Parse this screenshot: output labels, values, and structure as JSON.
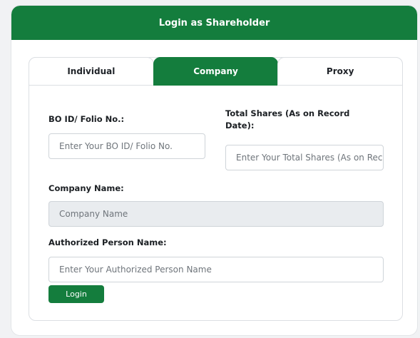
{
  "header": {
    "title": "Login as Shareholder"
  },
  "tabs": [
    {
      "label": "Individual",
      "active": false
    },
    {
      "label": "Company",
      "active": true
    },
    {
      "label": "Proxy",
      "active": false
    }
  ],
  "form": {
    "bo_id": {
      "label": "BO ID/ Folio No.:",
      "placeholder": "Enter Your BO ID/ Folio No."
    },
    "total_shares": {
      "label": "Total Shares (As on Record Date):",
      "placeholder": "Enter Your Total Shares (As on Record Date)"
    },
    "company_name": {
      "label": "Company Name:",
      "placeholder": "Company Name"
    },
    "authorized_person": {
      "label": "Authorized Person Name:",
      "placeholder": "Enter Your Authorized Person Name"
    },
    "login_label": "Login"
  },
  "colors": {
    "brand_green": "#147d3d",
    "background": "#f1f2f4",
    "readonly_bg": "#e9ecef"
  }
}
